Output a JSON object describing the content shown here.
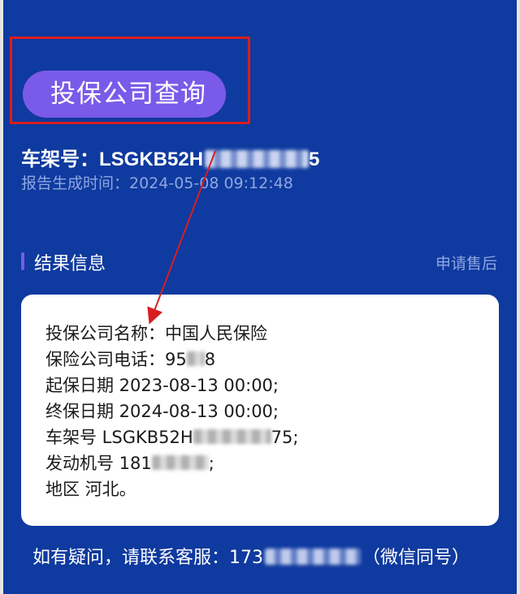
{
  "query_button": {
    "label": "投保公司查询"
  },
  "vehicle": {
    "vin_prefix": "车架号：LSGKB52H",
    "vin_suffix": "5",
    "report_time": "报告生成时间：2024-05-08 09:12:48"
  },
  "section": {
    "title": "结果信息",
    "action": "申请售后"
  },
  "result": {
    "company_name": "投保公司名称：中国人民保险",
    "phone_prefix": "保险公司电话：95",
    "phone_suffix": "8",
    "start_date": "起保日期 2023-08-13 00:00;",
    "end_date": "终保日期 2024-08-13 00:00;",
    "vin_prefix": "车架号 LSGKB52H",
    "vin_suffix": "75;",
    "engine_prefix": "发动机号 181",
    "engine_suffix": ";",
    "region": "地区 河北。"
  },
  "footer": {
    "contact_prefix": "如有疑问，请联系客服：173",
    "contact_suffix": "（微信同号）"
  },
  "colors": {
    "background": "#0f3a9f",
    "button": "#7a5ae9",
    "highlight": "#d81e1e",
    "card": "#ffffff"
  }
}
